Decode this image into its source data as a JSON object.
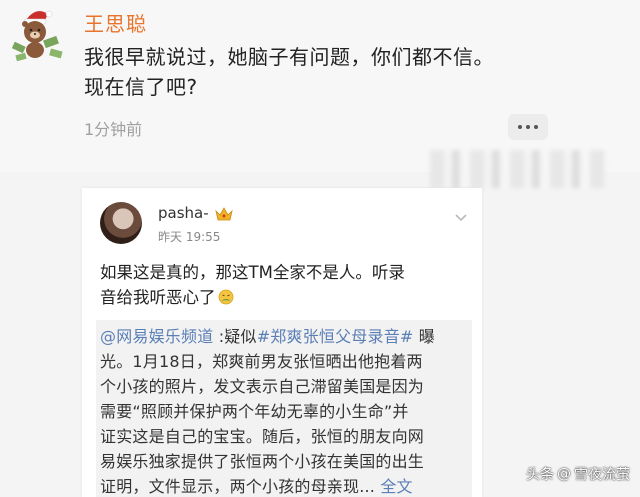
{
  "comment": {
    "user_name": "王思聪",
    "text_line1": "我很早就说过，她脑子有问题，你们都不信。",
    "text_line2": "现在信了吧?",
    "time": "1分钟前",
    "avatar_icon": "bear-avatar-icon",
    "more_icon": "more-dots-icon"
  },
  "post": {
    "user_name": "pasha-",
    "badge_icon": "crown-badge-icon",
    "time": "昨天 19:55",
    "text_line1": "如果这是真的，那这TM全家不是人。听录",
    "text_line2": "音给我听恶心了",
    "emoji_icon": "disgusted-emoji-icon",
    "repost": {
      "mention": "@网易娱乐频道",
      "lead": " :疑似",
      "hashtag": "#郑爽张恒父母录音#",
      "line1_tail": " 曝",
      "line2": "光。1月18日，郑爽前男友张恒晒出他抱着两",
      "line3": "个小孩的照片，发文表示自己滞留美国是因为",
      "line4": "需要“照顾并保护两个年幼无辜的小生命”并",
      "line5": "证实这是自己的宝宝。随后，张恒的朋友向网",
      "line6": "易娱乐独家提供了张恒两个小孩在美国的出生",
      "line7": "证明，文件显示，两个小孩的母亲现...",
      "fulltext": " 全文"
    }
  },
  "watermark": {
    "prefix": "头条",
    "at": "@",
    "account": "雪夜流萤"
  }
}
